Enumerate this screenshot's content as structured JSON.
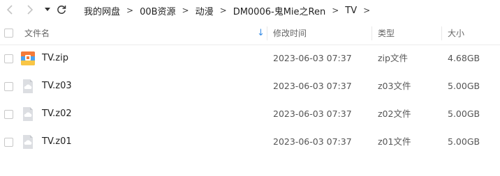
{
  "breadcrumb": [
    {
      "label": "我的网盘"
    },
    {
      "label": "00B资源"
    },
    {
      "label": "动漫"
    },
    {
      "label": "DM0006-鬼Mie之Ren"
    },
    {
      "label": "TV"
    }
  ],
  "breadcrumb_separator": ">",
  "columns": {
    "name": "文件名",
    "modified": "修改时间",
    "type": "类型",
    "size": "大小"
  },
  "sort_indicator": "↓",
  "files": [
    {
      "name": "TV.zip",
      "modified": "2023-06-03 07:37",
      "type": "zip文件",
      "size": "4.68GB",
      "icon": "zip-archive-icon"
    },
    {
      "name": "TV.z03",
      "modified": "2023-06-03 07:37",
      "type": "z03文件",
      "size": "5.00GB",
      "icon": "generic-file-icon"
    },
    {
      "name": "TV.z02",
      "modified": "2023-06-03 07:37",
      "type": "z02文件",
      "size": "5.00GB",
      "icon": "generic-file-icon"
    },
    {
      "name": "TV.z01",
      "modified": "2023-06-03 07:37",
      "type": "z01文件",
      "size": "5.00GB",
      "icon": "generic-file-icon"
    }
  ],
  "colors": {
    "accent": "#3a8ee6",
    "zip_orange": "#f47a39",
    "zip_yellow": "#f9c646",
    "zip_blue": "#4aa3f0",
    "generic_icon": "#d7d9dd"
  }
}
